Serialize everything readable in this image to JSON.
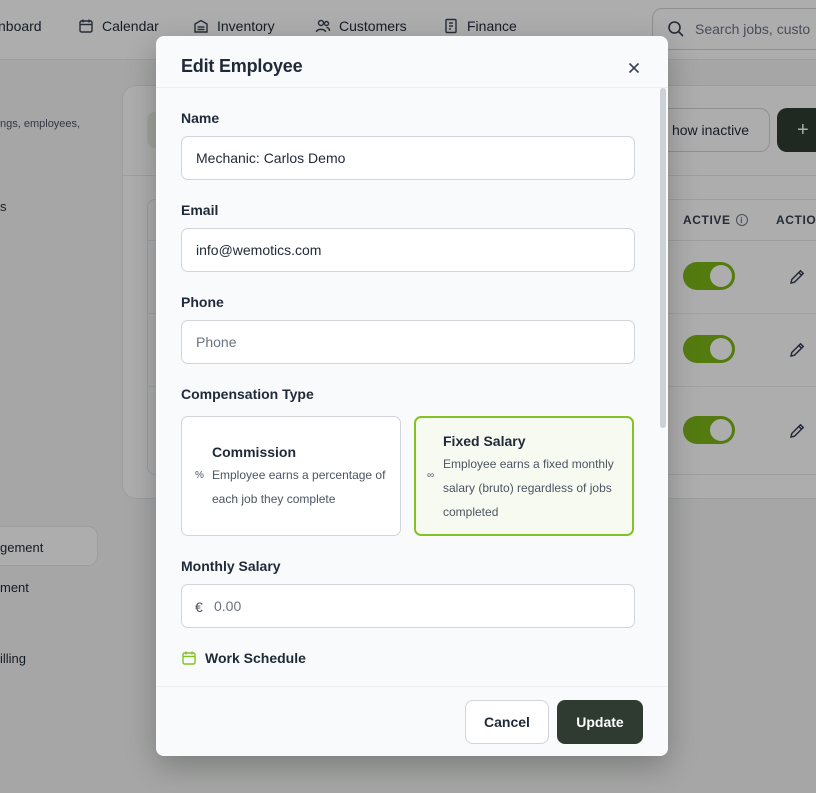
{
  "colors": {
    "accent_green": "#84c225",
    "toggle_green": "#7cb518",
    "primary_dark": "#2f3b31",
    "overlay": "rgba(0,0,0,0.32)"
  },
  "background": {
    "nav": [
      {
        "label": "nboard",
        "icon": "dashboard-icon"
      },
      {
        "label": "Calendar",
        "icon": "calendar-icon"
      },
      {
        "label": "Inventory",
        "icon": "inventory-icon"
      },
      {
        "label": "Customers",
        "icon": "customers-icon"
      },
      {
        "label": "Finance",
        "icon": "finance-icon"
      }
    ],
    "search_text": "Search jobs, custo",
    "sidebar": {
      "description": "ngs, employees,",
      "item_s": "s",
      "item_management": "gement",
      "item_ment": "ment",
      "item_billing": "illing"
    },
    "buttons": {
      "show_inactive": "how inactive",
      "add": "+"
    },
    "table": {
      "active_header": "ACTIVE",
      "actions_header": "ACTIO",
      "info_glyph": "i",
      "rows": [
        {
          "active": true
        },
        {
          "active": true
        },
        {
          "active": true
        }
      ]
    }
  },
  "modal": {
    "title": "Edit Employee",
    "fields": {
      "name": {
        "label": "Name",
        "value": "Mechanic: Carlos Demo"
      },
      "email": {
        "label": "Email",
        "value": "info@wemotics.com"
      },
      "phone": {
        "label": "Phone",
        "value": "",
        "placeholder": "Phone"
      }
    },
    "compensation": {
      "label": "Compensation Type",
      "selected": "fixed",
      "options": {
        "commission": {
          "title": "Commission",
          "icon_glyph": "%",
          "icon": "percent-icon",
          "desc_line1": "Employee earns a percentage of",
          "desc_line2": "each job they complete"
        },
        "fixed": {
          "title": "Fixed Salary",
          "icon_glyph": "∞",
          "icon": "infinity-icon",
          "desc_line1": "Employee earns a fixed monthly",
          "desc_line2": "salary (bruto) regardless of jobs",
          "desc_line3": "completed"
        }
      }
    },
    "monthly_salary": {
      "label": "Monthly Salary",
      "currency": "€",
      "placeholder": "0.00",
      "value": ""
    },
    "work_schedule": {
      "label": "Work Schedule",
      "icon": "calendar-icon"
    },
    "buttons": {
      "cancel": "Cancel",
      "update": "Update"
    }
  }
}
